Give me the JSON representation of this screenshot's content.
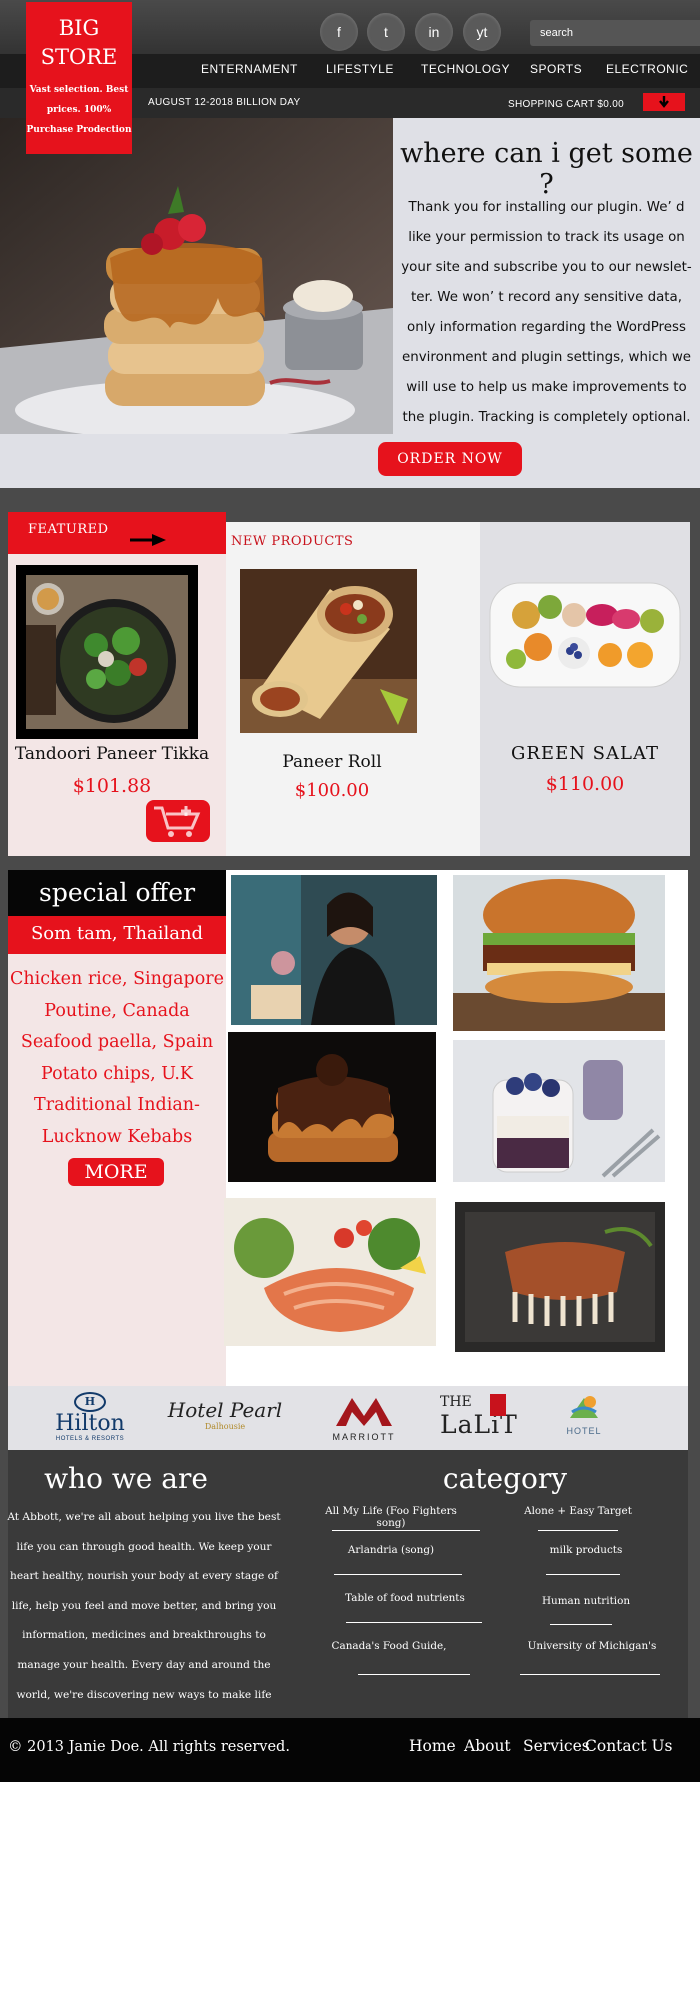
{
  "brand": {
    "title": "BIG STORE",
    "tagline": "Vast selection. Best prices. 100% Purchase Prodection"
  },
  "social": [
    "f",
    "t",
    "in",
    "yt"
  ],
  "search": {
    "placeholder": "search"
  },
  "nav": [
    "ENTERNAMENT",
    "LIFESTYLE",
    "TECHNOLOGY",
    "SPORTS",
    "ELECTRONIC"
  ],
  "promo": "AUGUST 12-2018 BILLION DAY",
  "cart": {
    "label": "SHOPPING CART $0.00",
    "icon": "arrow-down-icon"
  },
  "hero": {
    "title": "where can i get some ?",
    "text": "Thank you for installing our plugin. We’ d like your permission to track its usage on your site and subscribe you to our newslet-ter. We won’ t record any sensitive data, only information regarding the WordPress environment and plugin settings, which we will use to help us make improvements to the plugin. Tracking is completely optional.",
    "button": "ORDER NOW"
  },
  "featured": {
    "label": "FEATURED",
    "name": "Tandoori Paneer Tikka",
    "price": "$101.88"
  },
  "new_products": {
    "label": "NEW PRODUCTS",
    "items": [
      {
        "name": "Paneer Roll",
        "price": "$100.00"
      },
      {
        "name": "GREEN SALAT",
        "price": "$110.00"
      }
    ]
  },
  "special": {
    "title": "special offer",
    "subtitle": "Som tam, Thailand",
    "items": [
      "Chicken rice, Singapore",
      "Poutine, Canada",
      "Seafood paella, Spain",
      "Potato chips,  U.K",
      "Traditional Indian-",
      "Lucknow Kebabs"
    ],
    "button": "MORE"
  },
  "brands": [
    "Hilton",
    "HOTELS & RESORTS",
    "Hotel Pearl",
    "Dalhousie",
    "MARRIOTT",
    "THE",
    "LaLiT",
    "HOTEL"
  ],
  "about": {
    "title": "who we are",
    "text": "At Abbott, we're all about helping you live the best life you can through good health. We keep your heart healthy, nourish your body at every stage of life, help you feel and move better, and bring you information, medicines and breakthroughs to manage your health. Every day and around the world, we're discovering new ways to make life better."
  },
  "category": {
    "title": "category",
    "left": [
      "All My Life (Foo Fighters song)",
      "Arlandria (song)",
      "Table of food nutrients",
      "Canada's Food Guide,"
    ],
    "right": [
      "Alone + Easy Target",
      "milk products",
      "Human nutrition",
      "University of Michigan's"
    ]
  },
  "footer": {
    "copyright": "© 2013 Janie Doe.  All rights reserved.",
    "links": [
      "Home",
      "About",
      "Services",
      "Contact Us"
    ]
  },
  "colors": {
    "accent": "#e6121c",
    "dark": "#4a4a4a",
    "footer": "#050505"
  }
}
